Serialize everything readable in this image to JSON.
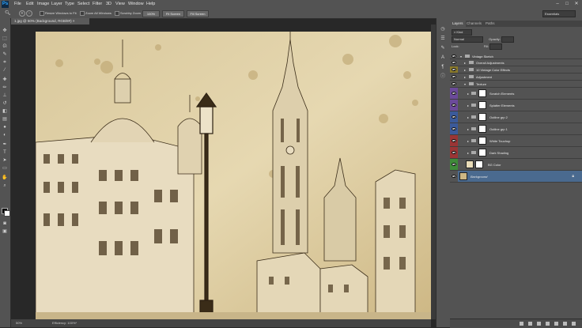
{
  "app": {
    "logo": "Ps"
  },
  "menu": [
    "File",
    "Edit",
    "Image",
    "Layer",
    "Type",
    "Select",
    "Filter",
    "3D",
    "View",
    "Window",
    "Help"
  ],
  "window_controls": [
    "–",
    "□",
    "✕"
  ],
  "options": {
    "checks": [
      "Resize Windows to Fit",
      "Zoom All Windows",
      "Scrubby Zoom"
    ],
    "buttons": [
      "100%",
      "Fit Screen",
      "Fill Screen"
    ],
    "workspace": "Essentials"
  },
  "document": {
    "tab_title": "1.jpg @ 50% (Background, RGB/8#) ×",
    "zoom": "50%",
    "status": "Efficiency: 100%*"
  },
  "panel": {
    "tabs": [
      "Layers",
      "Channels",
      "Paths"
    ],
    "kind_label": "Kind",
    "blend_mode": "Normal",
    "opacity_label": "Opacity:",
    "lock_label": "Lock:",
    "fill_label": "Fill:"
  },
  "layers": [
    {
      "name": "Vintage Sketch",
      "indent": 0,
      "type": "group",
      "color": "#535353"
    },
    {
      "name": "Overall Adjustments",
      "indent": 1,
      "type": "group",
      "color": "#535353"
    },
    {
      "name": "10 Vintage Color Effects",
      "indent": 1,
      "type": "group",
      "color": "#8a7a2c"
    },
    {
      "name": "Adjustment",
      "indent": 1,
      "type": "group",
      "color": "#535353"
    },
    {
      "name": "Texture",
      "indent": 1,
      "type": "group",
      "color": "#535353"
    },
    {
      "name": "Scratch Elements",
      "indent": 2,
      "type": "layer",
      "color": "#6b4a9a"
    },
    {
      "name": "Splatter Elements",
      "indent": 2,
      "type": "layer",
      "color": "#6b4a9a"
    },
    {
      "name": "Outline grp 2",
      "indent": 2,
      "type": "layer",
      "color": "#3b5a9a"
    },
    {
      "name": "Outline grp 1",
      "indent": 2,
      "type": "layer",
      "color": "#3b5a9a"
    },
    {
      "name": "White Touchup",
      "indent": 2,
      "type": "layer",
      "color": "#9a3535"
    },
    {
      "name": "Dark Shading",
      "indent": 2,
      "type": "layer",
      "color": "#9a3535"
    },
    {
      "name": "BG Color",
      "indent": 2,
      "type": "layer",
      "color": "#3f8a3a"
    },
    {
      "name": "Background",
      "indent": 0,
      "type": "background",
      "color": "#535353",
      "selected": true
    }
  ],
  "colors": {
    "accent_selected": "#4a6a8f",
    "canvas_bg": "#282828",
    "ui_bg": "#535353"
  }
}
